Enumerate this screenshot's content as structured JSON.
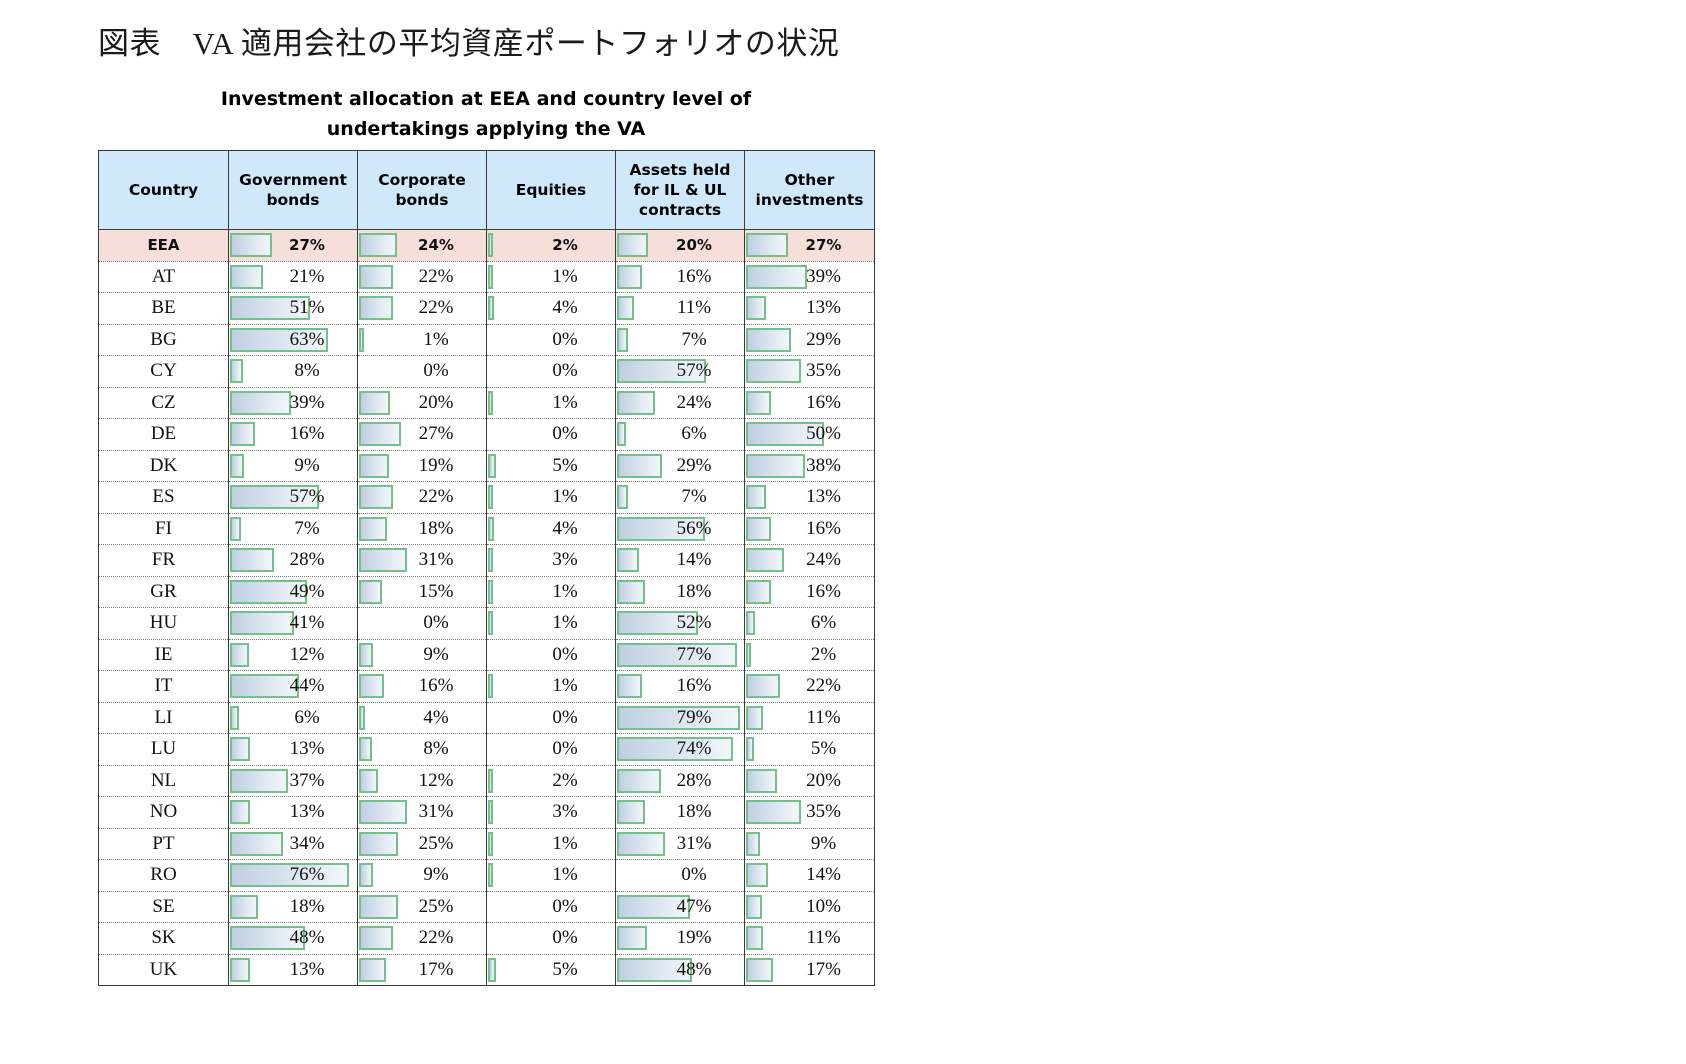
{
  "caption_jp": "図表　VA 適用会社の平均資産ポートフォリオの状況",
  "chart_title_line1": "Investment allocation at EEA and country level of",
  "chart_title_line2": "undertakings applying the VA",
  "colors": {
    "header_fill": "#cfe9fb",
    "eea_row_fill": "#f6ded9",
    "bar_border": "#73c08a",
    "bar_fill_start": "#bfcfe2",
    "bar_fill_end": "#f2f6fa",
    "grid": "#3a3a3a"
  },
  "chart_data": {
    "type": "table",
    "title": "Investment allocation at EEA and country level of undertakings applying the VA",
    "xlabel": "",
    "ylabel": "",
    "unit": "%",
    "bar_scale_max": 80,
    "columns": [
      "Country",
      "Government bonds",
      "Corporate bonds",
      "Equities",
      "Assets held for IL & UL contracts",
      "Other investments"
    ],
    "column_headers": [
      {
        "line1": "Country",
        "line2": "",
        "line3": ""
      },
      {
        "line1": "Government",
        "line2": "bonds",
        "line3": ""
      },
      {
        "line1": "Corporate",
        "line2": "bonds",
        "line3": ""
      },
      {
        "line1": "Equities",
        "line2": "",
        "line3": ""
      },
      {
        "line1": "Assets held",
        "line2": "for IL & UL",
        "line3": "contracts"
      },
      {
        "line1": "Other",
        "line2": "investments",
        "line3": ""
      }
    ],
    "categories": [
      "EEA",
      "AT",
      "BE",
      "BG",
      "CY",
      "CZ",
      "DE",
      "DK",
      "ES",
      "FI",
      "FR",
      "GR",
      "HU",
      "IE",
      "IT",
      "LI",
      "LU",
      "NL",
      "NO",
      "PT",
      "RO",
      "SE",
      "SK",
      "UK"
    ],
    "series": [
      {
        "name": "Government bonds",
        "values": [
          27,
          21,
          51,
          63,
          8,
          39,
          16,
          9,
          57,
          7,
          28,
          49,
          41,
          12,
          44,
          6,
          13,
          37,
          13,
          34,
          76,
          18,
          48,
          13
        ]
      },
      {
        "name": "Corporate bonds",
        "values": [
          24,
          22,
          22,
          1,
          0,
          20,
          27,
          19,
          22,
          18,
          31,
          15,
          0,
          9,
          16,
          4,
          8,
          12,
          31,
          25,
          9,
          25,
          22,
          17
        ]
      },
      {
        "name": "Equities",
        "values": [
          2,
          1,
          4,
          0,
          0,
          1,
          0,
          5,
          1,
          4,
          3,
          1,
          1,
          0,
          1,
          0,
          0,
          2,
          3,
          1,
          1,
          0,
          0,
          5
        ]
      },
      {
        "name": "Assets held for IL & UL contracts",
        "values": [
          20,
          16,
          11,
          7,
          57,
          24,
          6,
          29,
          7,
          56,
          14,
          18,
          52,
          77,
          16,
          79,
          74,
          28,
          18,
          31,
          0,
          47,
          19,
          48
        ]
      },
      {
        "name": "Other investments",
        "values": [
          27,
          39,
          13,
          29,
          35,
          16,
          50,
          38,
          13,
          16,
          24,
          16,
          6,
          2,
          22,
          11,
          5,
          20,
          35,
          9,
          14,
          10,
          11,
          17
        ]
      }
    ],
    "rows": [
      {
        "country": "EEA",
        "highlight": true,
        "values": [
          27,
          24,
          2,
          20,
          27
        ],
        "labels": [
          "27%",
          "24%",
          "2%",
          "20%",
          "27%"
        ]
      },
      {
        "country": "AT",
        "highlight": false,
        "values": [
          21,
          22,
          1,
          16,
          39
        ],
        "labels": [
          "21%",
          "22%",
          "1%",
          "16%",
          "39%"
        ]
      },
      {
        "country": "BE",
        "highlight": false,
        "values": [
          51,
          22,
          4,
          11,
          13
        ],
        "labels": [
          "51%",
          "22%",
          "4%",
          "11%",
          "13%"
        ]
      },
      {
        "country": "BG",
        "highlight": false,
        "values": [
          63,
          1,
          0,
          7,
          29
        ],
        "labels": [
          "63%",
          "1%",
          "0%",
          "7%",
          "29%"
        ]
      },
      {
        "country": "CY",
        "highlight": false,
        "values": [
          8,
          0,
          0,
          57,
          35
        ],
        "labels": [
          "8%",
          "0%",
          "0%",
          "57%",
          "35%"
        ]
      },
      {
        "country": "CZ",
        "highlight": false,
        "values": [
          39,
          20,
          1,
          24,
          16
        ],
        "labels": [
          "39%",
          "20%",
          "1%",
          "24%",
          "16%"
        ]
      },
      {
        "country": "DE",
        "highlight": false,
        "values": [
          16,
          27,
          0,
          6,
          50
        ],
        "labels": [
          "16%",
          "27%",
          "0%",
          "6%",
          "50%"
        ]
      },
      {
        "country": "DK",
        "highlight": false,
        "values": [
          9,
          19,
          5,
          29,
          38
        ],
        "labels": [
          "9%",
          "19%",
          "5%",
          "29%",
          "38%"
        ]
      },
      {
        "country": "ES",
        "highlight": false,
        "values": [
          57,
          22,
          1,
          7,
          13
        ],
        "labels": [
          "57%",
          "22%",
          "1%",
          "7%",
          "13%"
        ]
      },
      {
        "country": "FI",
        "highlight": false,
        "values": [
          7,
          18,
          4,
          56,
          16
        ],
        "labels": [
          "7%",
          "18%",
          "4%",
          "56%",
          "16%"
        ]
      },
      {
        "country": "FR",
        "highlight": false,
        "values": [
          28,
          31,
          3,
          14,
          24
        ],
        "labels": [
          "28%",
          "31%",
          "3%",
          "14%",
          "24%"
        ]
      },
      {
        "country": "GR",
        "highlight": false,
        "values": [
          49,
          15,
          1,
          18,
          16
        ],
        "labels": [
          "49%",
          "15%",
          "1%",
          "18%",
          "16%"
        ]
      },
      {
        "country": "HU",
        "highlight": false,
        "values": [
          41,
          0,
          1,
          52,
          6
        ],
        "labels": [
          "41%",
          "0%",
          "1%",
          "52%",
          "6%"
        ]
      },
      {
        "country": "IE",
        "highlight": false,
        "values": [
          12,
          9,
          0,
          77,
          2
        ],
        "labels": [
          "12%",
          "9%",
          "0%",
          "77%",
          "2%"
        ]
      },
      {
        "country": "IT",
        "highlight": false,
        "values": [
          44,
          16,
          1,
          16,
          22
        ],
        "labels": [
          "44%",
          "16%",
          "1%",
          "16%",
          "22%"
        ]
      },
      {
        "country": "LI",
        "highlight": false,
        "values": [
          6,
          4,
          0,
          79,
          11
        ],
        "labels": [
          "6%",
          "4%",
          "0%",
          "79%",
          "11%"
        ]
      },
      {
        "country": "LU",
        "highlight": false,
        "values": [
          13,
          8,
          0,
          74,
          5
        ],
        "labels": [
          "13%",
          "8%",
          "0%",
          "74%",
          "5%"
        ]
      },
      {
        "country": "NL",
        "highlight": false,
        "values": [
          37,
          12,
          2,
          28,
          20
        ],
        "labels": [
          "37%",
          "12%",
          "2%",
          "28%",
          "20%"
        ]
      },
      {
        "country": "NO",
        "highlight": false,
        "values": [
          13,
          31,
          3,
          18,
          35
        ],
        "labels": [
          "13%",
          "31%",
          "3%",
          "18%",
          "35%"
        ]
      },
      {
        "country": "PT",
        "highlight": false,
        "values": [
          34,
          25,
          1,
          31,
          9
        ],
        "labels": [
          "34%",
          "25%",
          "1%",
          "31%",
          "9%"
        ]
      },
      {
        "country": "RO",
        "highlight": false,
        "values": [
          76,
          9,
          1,
          0,
          14
        ],
        "labels": [
          "76%",
          "9%",
          "1%",
          "0%",
          "14%"
        ]
      },
      {
        "country": "SE",
        "highlight": false,
        "values": [
          18,
          25,
          0,
          47,
          10
        ],
        "labels": [
          "18%",
          "25%",
          "0%",
          "47%",
          "10%"
        ]
      },
      {
        "country": "SK",
        "highlight": false,
        "values": [
          48,
          22,
          0,
          19,
          11
        ],
        "labels": [
          "48%",
          "22%",
          "0%",
          "19%",
          "11%"
        ]
      },
      {
        "country": "UK",
        "highlight": false,
        "values": [
          13,
          17,
          5,
          48,
          17
        ],
        "labels": [
          "13%",
          "17%",
          "5%",
          "48%",
          "17%"
        ]
      }
    ]
  }
}
